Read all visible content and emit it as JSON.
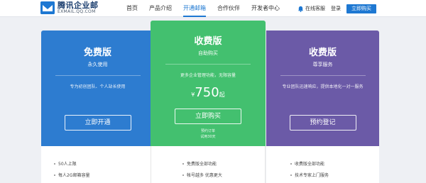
{
  "header": {
    "logo_cn": "腾讯企业邮",
    "logo_en": "EXMAIL.QQ.COM",
    "nav": [
      "首页",
      "产品介绍",
      "开通邮箱",
      "合作伙伴",
      "开发者中心"
    ],
    "active_nav": "开通邮箱",
    "service_label": "在线客服",
    "login_label": "登录",
    "buy_label": "立即购买"
  },
  "plans": {
    "free": {
      "title": "免费版",
      "subtitle": "永久使用",
      "desc": "专为初创团队、个人站长使用",
      "button": "立即开通",
      "features": [
        "50人上限",
        "每人2G邮箱容量"
      ]
    },
    "paid": {
      "title": "收费版",
      "subtitle": "自助购买",
      "desc": "更多企业管理功能，无限容量",
      "currency": "¥",
      "price": "750",
      "price_suffix": "起",
      "button": "立即购买",
      "note1": "预约订单",
      "note2": "试用30天",
      "features": [
        "免费版全部功能",
        "帐号越多 优惠更大"
      ]
    },
    "vip": {
      "title": "收费版",
      "subtitle": "尊享服务",
      "desc": "专业团队迅速响应，提供本地化一对一服务",
      "button": "预约登记",
      "features": [
        "收费版全部功能",
        "技术专家上门服务"
      ]
    }
  },
  "colors": {
    "blue": "#2d7cd0",
    "green": "#43c06f",
    "purple": "#6b5aa7",
    "accent": "#1e78d2"
  }
}
